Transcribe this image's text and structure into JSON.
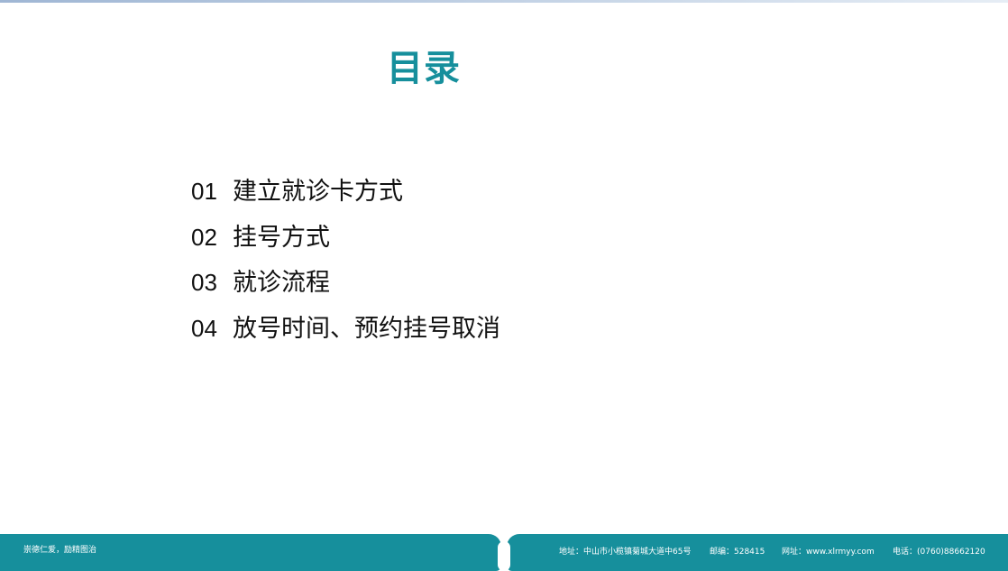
{
  "title": "目录",
  "toc": [
    {
      "num": "01",
      "label": "建立就诊卡方式"
    },
    {
      "num": "02",
      "label": "挂号方式"
    },
    {
      "num": "03",
      "label": "就诊流程"
    },
    {
      "num": "04",
      "label": "放号时间、预约挂号取消"
    }
  ],
  "footer": {
    "slogan": "崇德仁爱，励精图治",
    "address": "地址：中山市小榄镇菊城大道中65号",
    "zip": "邮编：528415",
    "website": "网址：www.xlrmyy.com",
    "phone": "电话：(0760)88662120"
  },
  "colors": {
    "accent": "#168f9c",
    "text": "#111111"
  }
}
